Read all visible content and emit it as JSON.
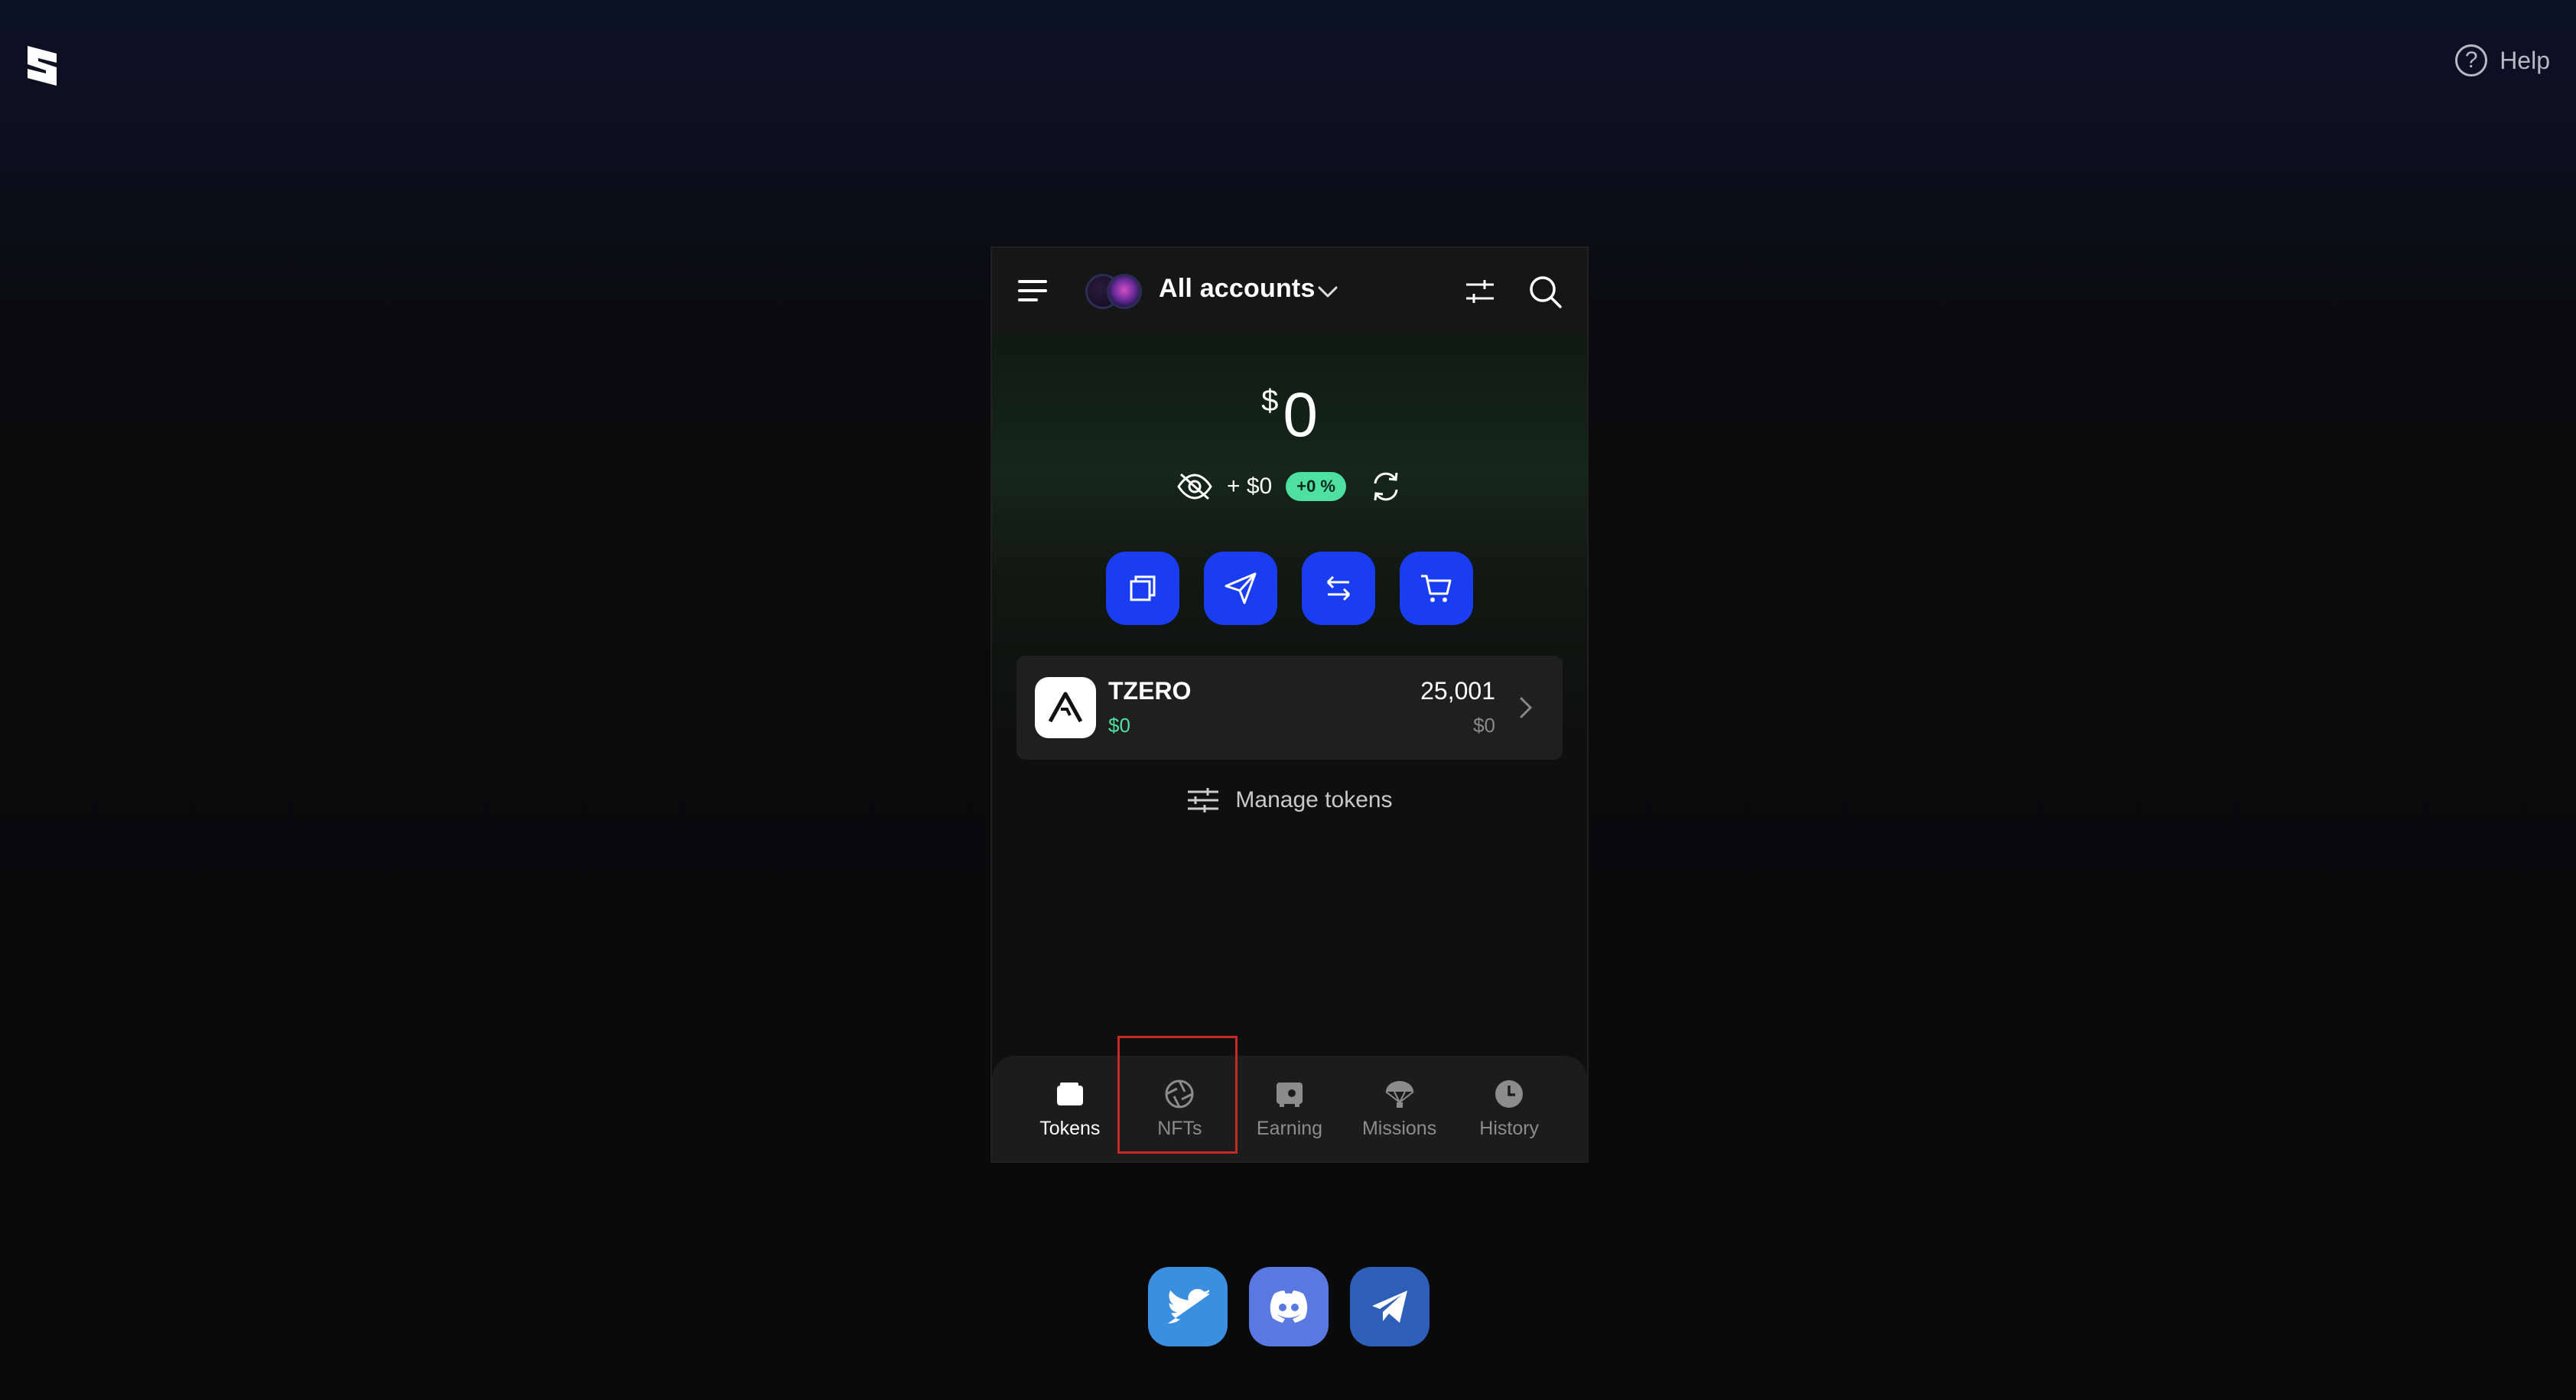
{
  "header": {
    "help_label": "Help",
    "help_glyph": "?"
  },
  "wallet": {
    "account_selector": {
      "label": "All accounts"
    },
    "balance": {
      "currency": "$",
      "amount": "0"
    },
    "change": {
      "amount": "+ $0",
      "percent": "+0 %"
    },
    "actions": [
      "copy-icon",
      "send-icon",
      "swap-icon",
      "cart-icon"
    ],
    "tokens": [
      {
        "symbol": "TZERO",
        "usd_value": "$0",
        "amount": "25,001",
        "amount_usd": "$0"
      }
    ],
    "manage_tokens_label": "Manage tokens",
    "tabs": [
      {
        "label": "Tokens",
        "icon": "wallet-icon",
        "active": true
      },
      {
        "label": "NFTs",
        "icon": "aperture-icon",
        "active": false
      },
      {
        "label": "Earning",
        "icon": "vault-icon",
        "active": false
      },
      {
        "label": "Missions",
        "icon": "parachute-icon",
        "active": false
      },
      {
        "label": "History",
        "icon": "clock-icon",
        "active": false
      }
    ]
  },
  "socials": [
    "twitter-icon",
    "discord-icon",
    "telegram-icon"
  ],
  "colors": {
    "accent_blue": "#1b3df2",
    "positive_green": "#4de0a1",
    "highlight_red": "#c62a25",
    "twitter": "#3b8fe0",
    "discord": "#5a78e2",
    "telegram": "#2d5fb8"
  }
}
